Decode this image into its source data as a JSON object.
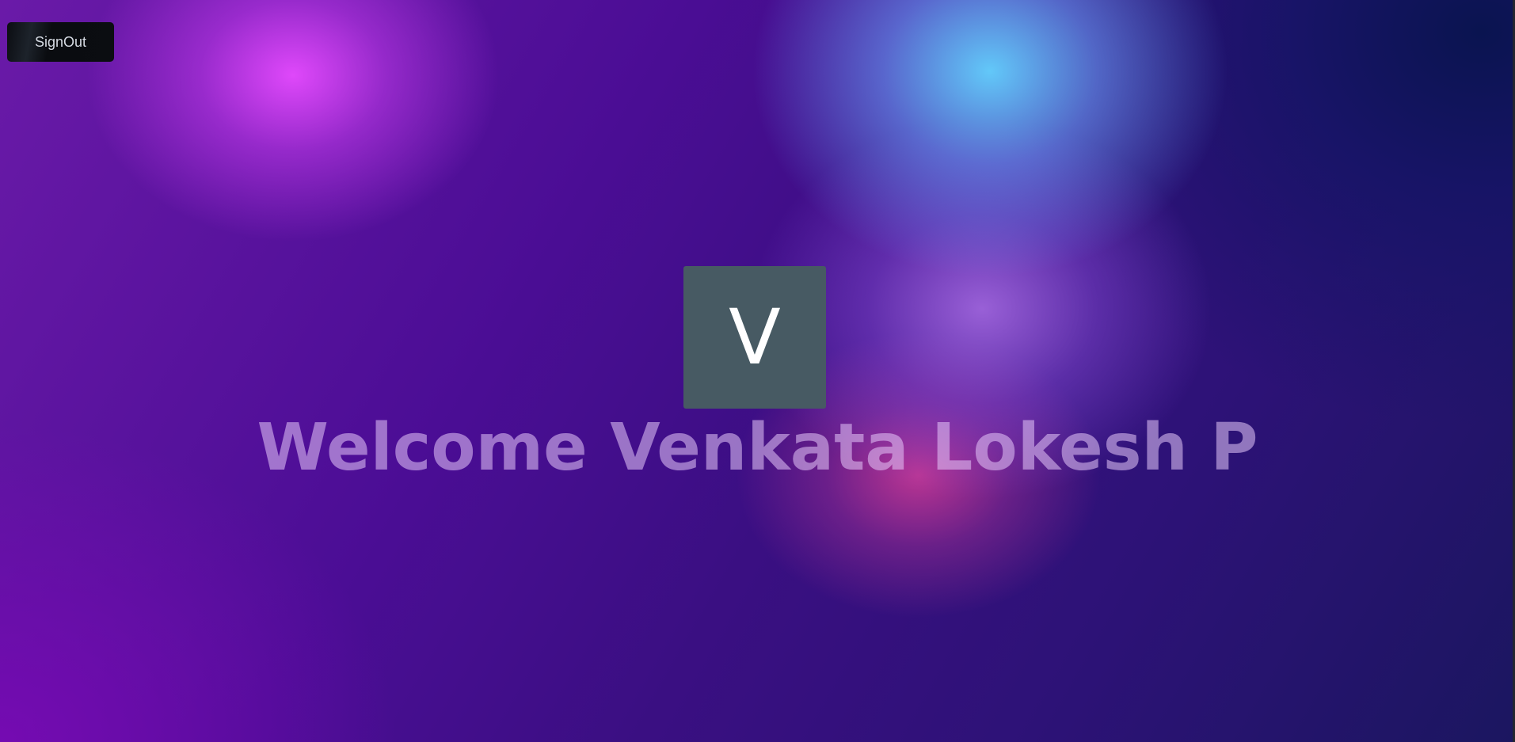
{
  "header": {
    "signout_label": "SignOut"
  },
  "profile": {
    "avatar_initial": "V",
    "welcome_text": "Welcome Venkata Lokesh P"
  },
  "colors": {
    "avatar_bg": "#475a63",
    "button_bg": "#0b0d12",
    "background_primary": "#4b0d95",
    "glow_pink": "#e64bff",
    "glow_cyan": "#64d2ff",
    "glow_magenta": "#d23c96"
  }
}
